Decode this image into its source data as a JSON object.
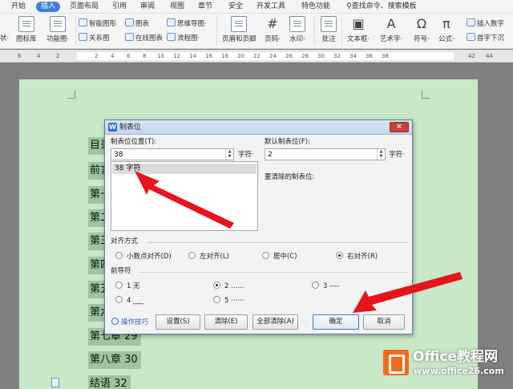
{
  "menu": {
    "tabs": [
      "开始",
      "插入",
      "页面布局",
      "引用",
      "审阅",
      "视图",
      "章节",
      "安全",
      "开发工具",
      "特色功能"
    ],
    "active_tab": "插入",
    "search_text": "查找命令、搜索模板"
  },
  "ribbon": {
    "left_fragments": [
      "状·",
      "图标库",
      "功能图·"
    ],
    "small": {
      "smart_shape": "智能图形",
      "chart": "图表",
      "mind_map": "思维导图·",
      "relation": "关系图",
      "online_chart": "在线图表",
      "flow_chart": "流程图·"
    },
    "big": {
      "header_footer": "页眉和页脚",
      "page_number": "页码·",
      "watermark": "水印·",
      "comment": "批注",
      "textbox": "文本框·",
      "wordart": "艺术字·",
      "symbol": "符号·",
      "formula": "公式·"
    },
    "right": {
      "insert_number": "插入数字",
      "drop_cap": "首字下沉"
    }
  },
  "ruler": {
    "numbers": [
      "6",
      "4",
      "2",
      "2",
      "4",
      "6",
      "8",
      "10",
      "12",
      "14",
      "16",
      "18",
      "20",
      "22",
      "24",
      "26",
      "28",
      "30",
      "32",
      "34",
      "36",
      "38",
      "42",
      "44"
    ]
  },
  "document": {
    "lines": [
      "目录",
      "前言",
      "第一",
      "第二",
      "第三",
      "第四",
      "第五",
      "第六",
      "第七章 29",
      "第八章 30",
      "结语 32"
    ]
  },
  "dialog": {
    "title": "制表位",
    "close_symbol": "×",
    "tab_position_label": "制表位位置(T):",
    "tab_position_value": "38",
    "tab_position_unit": "字符·",
    "default_tab_label": "默认制表位(F):",
    "default_tab_value": "2",
    "default_tab_unit": "字符·",
    "clear_label": "要清除的制表位:",
    "list_items": [
      "38 字符"
    ],
    "alignment": {
      "title": "对齐方式",
      "options": [
        "小数点对齐(D)",
        "左对齐(L)",
        "居中(C)",
        "右对齐(R)"
      ],
      "selected": "右对齐(R)"
    },
    "leader": {
      "title": "前导符",
      "options": [
        "1 无",
        "2 ......",
        "3 ----",
        "4 ___",
        "5 ······"
      ],
      "selected": "2 ......"
    },
    "tips_link": "操作技巧",
    "buttons": {
      "settings": "设置(S)",
      "clear": "清除(E)",
      "clear_all": "全部清除(A)",
      "ok": "确定",
      "cancel": "取消"
    }
  },
  "watermark": {
    "brand": "Office教程网",
    "url": "www.office26.com"
  },
  "colors": {
    "accent": "#3c7fd6",
    "page_bg": "#c8e8c8",
    "arrow_red": "#e4161c",
    "logo_orange": "#f26b1d"
  }
}
